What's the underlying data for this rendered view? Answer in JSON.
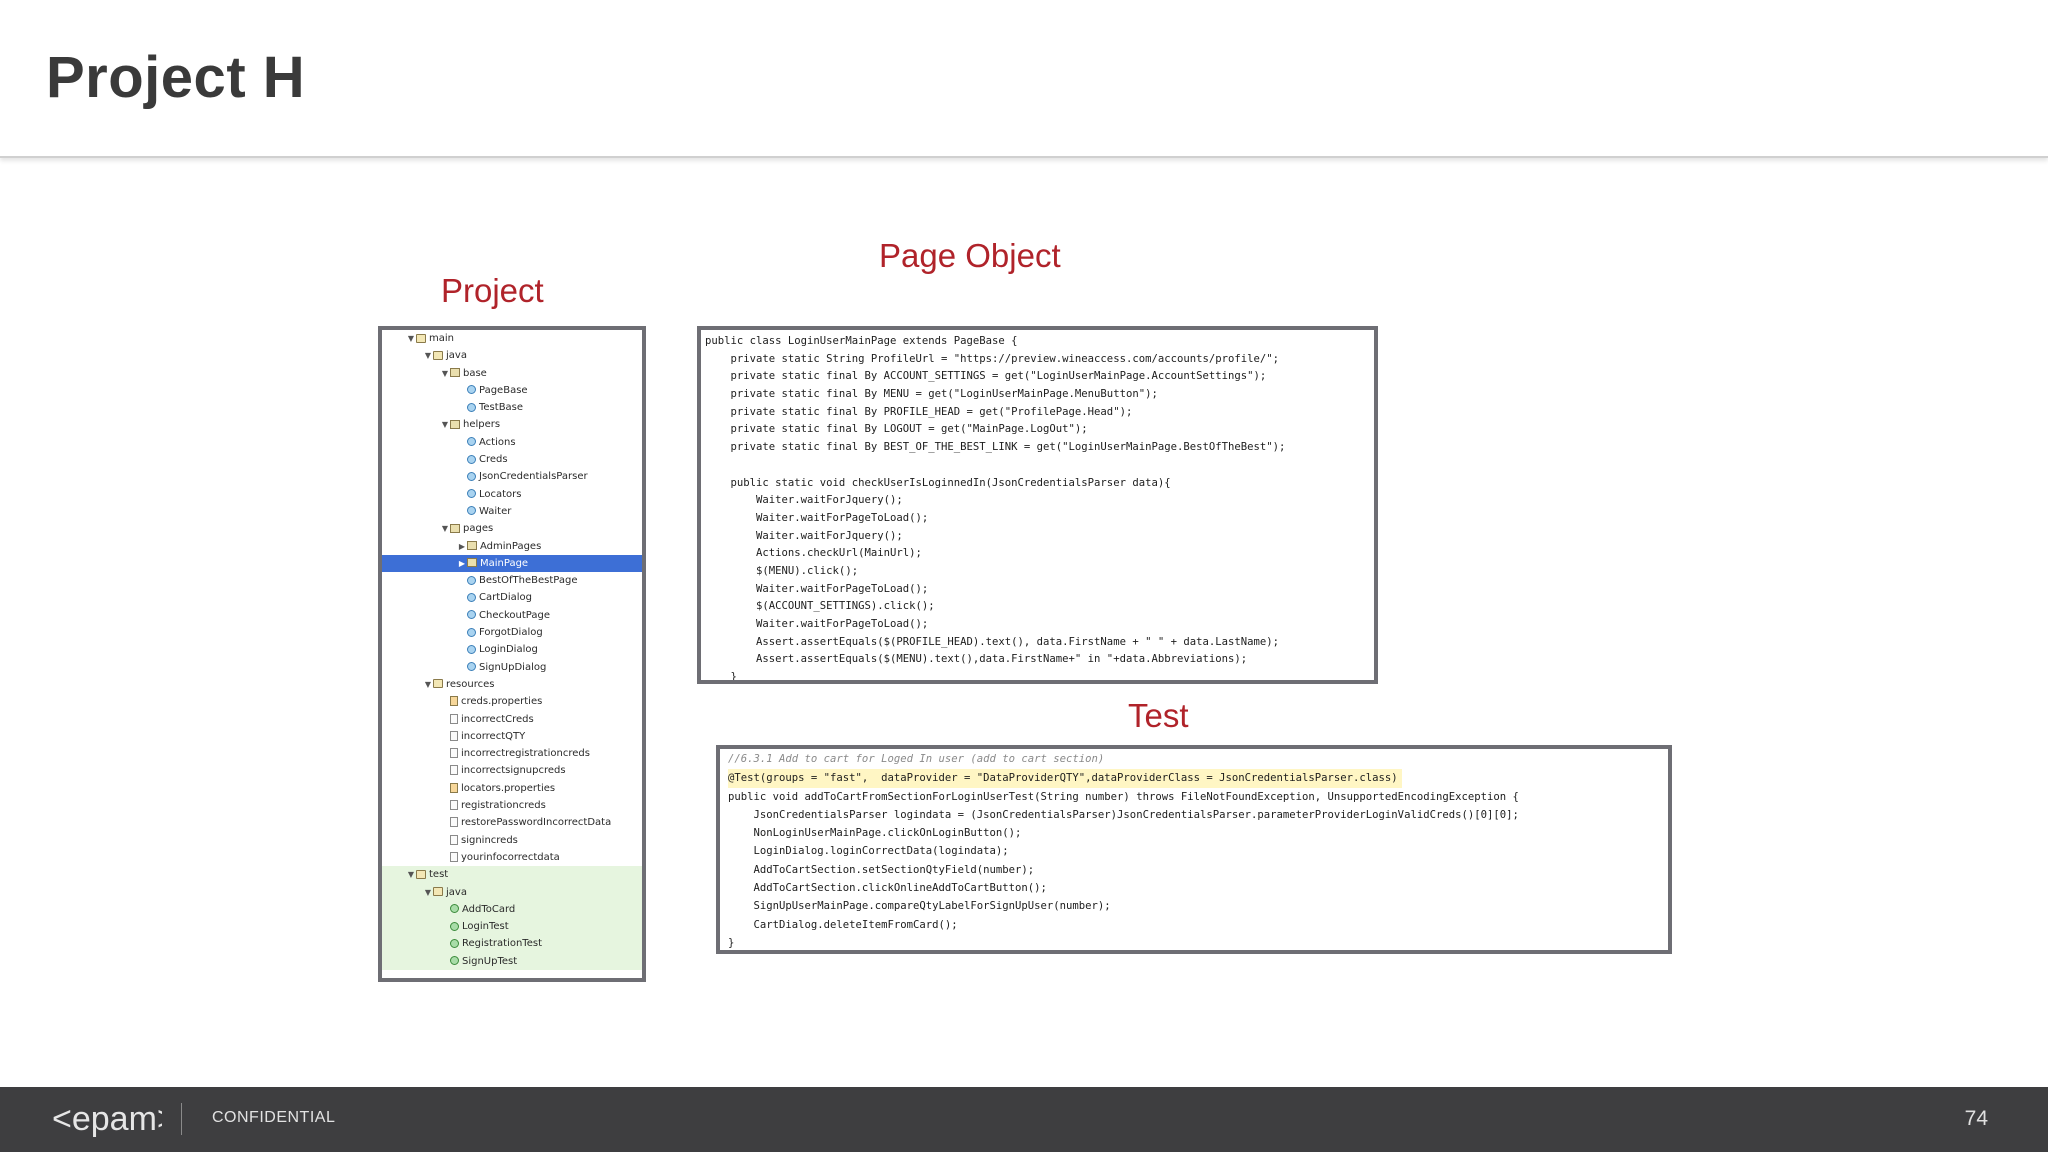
{
  "slide": {
    "title": "Project H"
  },
  "sections": {
    "project": "Project",
    "page_object": "Page Object",
    "test": "Test"
  },
  "tree": [
    {
      "label": "main",
      "icon": "folder-icon",
      "toggle": "▼",
      "indent": 0
    },
    {
      "label": "java",
      "icon": "folder-icon",
      "toggle": "▼",
      "indent": 1
    },
    {
      "label": "base",
      "icon": "package-icon",
      "toggle": "▼",
      "indent": 2
    },
    {
      "label": "PageBase",
      "icon": "class-icon",
      "toggle": "",
      "indent": 3
    },
    {
      "label": "TestBase",
      "icon": "class-icon",
      "toggle": "",
      "indent": 3
    },
    {
      "label": "helpers",
      "icon": "package-icon",
      "toggle": "▼",
      "indent": 2
    },
    {
      "label": "Actions",
      "icon": "class-icon",
      "toggle": "",
      "indent": 3
    },
    {
      "label": "Creds",
      "icon": "class-icon",
      "toggle": "",
      "indent": 3
    },
    {
      "label": "JsonCredentialsParser",
      "icon": "class-icon",
      "toggle": "",
      "indent": 3
    },
    {
      "label": "Locators",
      "icon": "class-icon",
      "toggle": "",
      "indent": 3
    },
    {
      "label": "Waiter",
      "icon": "class-icon",
      "toggle": "",
      "indent": 3
    },
    {
      "label": "pages",
      "icon": "package-icon",
      "toggle": "▼",
      "indent": 2
    },
    {
      "label": "AdminPages",
      "icon": "package-icon",
      "toggle": "▶",
      "indent": 3
    },
    {
      "label": "MainPage",
      "icon": "package-icon",
      "toggle": "▶",
      "indent": 3,
      "selected": true
    },
    {
      "label": "BestOfTheBestPage",
      "icon": "class-icon",
      "toggle": "",
      "indent": 3
    },
    {
      "label": "CartDialog",
      "icon": "class-icon",
      "toggle": "",
      "indent": 3
    },
    {
      "label": "CheckoutPage",
      "icon": "class-icon",
      "toggle": "",
      "indent": 3
    },
    {
      "label": "ForgotDialog",
      "icon": "class-icon",
      "toggle": "",
      "indent": 3
    },
    {
      "label": "LoginDialog",
      "icon": "class-icon",
      "toggle": "",
      "indent": 3
    },
    {
      "label": "SignUpDialog",
      "icon": "class-icon",
      "toggle": "",
      "indent": 3
    },
    {
      "label": "resources",
      "icon": "folder-icon",
      "toggle": "▼",
      "indent": 1
    },
    {
      "label": "creds.properties",
      "icon": "properties-file-icon",
      "toggle": "",
      "indent": 2
    },
    {
      "label": "incorrectCreds",
      "icon": "file-icon",
      "toggle": "",
      "indent": 2
    },
    {
      "label": "incorrectQTY",
      "icon": "file-icon",
      "toggle": "",
      "indent": 2
    },
    {
      "label": "incorrectregistrationcreds",
      "icon": "file-icon",
      "toggle": "",
      "indent": 2
    },
    {
      "label": "incorrectsignupcreds",
      "icon": "file-icon",
      "toggle": "",
      "indent": 2
    },
    {
      "label": "locators.properties",
      "icon": "properties-file-icon",
      "toggle": "",
      "indent": 2
    },
    {
      "label": "registrationcreds",
      "icon": "file-icon",
      "toggle": "",
      "indent": 2
    },
    {
      "label": "restorePasswordIncorrectData",
      "icon": "file-icon",
      "toggle": "",
      "indent": 2
    },
    {
      "label": "signincreds",
      "icon": "file-icon",
      "toggle": "",
      "indent": 2
    },
    {
      "label": "yourinfocorrectdata",
      "icon": "file-icon",
      "toggle": "",
      "indent": 2
    },
    {
      "label": "test",
      "icon": "folder-icon",
      "toggle": "▼",
      "indent": 0,
      "green": true
    },
    {
      "label": "java",
      "icon": "folder-icon",
      "toggle": "▼",
      "indent": 1,
      "green": true
    },
    {
      "label": "AddToCard",
      "icon": "test-class-icon",
      "toggle": "",
      "indent": 2,
      "green": true
    },
    {
      "label": "LoginTest",
      "icon": "test-class-icon",
      "toggle": "",
      "indent": 2,
      "green": true
    },
    {
      "label": "RegistrationTest",
      "icon": "test-class-icon",
      "toggle": "",
      "indent": 2,
      "green": true
    },
    {
      "label": "SignUpTest",
      "icon": "test-class-icon",
      "toggle": "",
      "indent": 2,
      "green": true
    }
  ],
  "page_object_code": [
    "public class LoginUserMainPage extends PageBase {",
    "    private static String ProfileUrl = \"https://preview.wineaccess.com/accounts/profile/\";",
    "    private static final By ACCOUNT_SETTINGS = get(\"LoginUserMainPage.AccountSettings\");",
    "    private static final By MENU = get(\"LoginUserMainPage.MenuButton\");",
    "    private static final By PROFILE_HEAD = get(\"ProfilePage.Head\");",
    "    private static final By LOGOUT = get(\"MainPage.LogOut\");",
    "    private static final By BEST_OF_THE_BEST_LINK = get(\"LoginUserMainPage.BestOfTheBest\");",
    "",
    "    public static void checkUserIsLoginnedIn(JsonCredentialsParser data){",
    "        Waiter.waitForJquery();",
    "        Waiter.waitForPageToLoad();",
    "        Waiter.waitForJquery();",
    "        Actions.checkUrl(MainUrl);",
    "        $(MENU).click();",
    "        Waiter.waitForPageToLoad();",
    "        $(ACCOUNT_SETTINGS).click();",
    "        Waiter.waitForPageToLoad();",
    "        Assert.assertEquals($(PROFILE_HEAD).text(), data.FirstName + \" \" + data.LastName);",
    "        Assert.assertEquals($(MENU).text(),data.FirstName+\" in \"+data.Abbreviations);",
    "    }"
  ],
  "test_code": [
    "//6.3.1 Add to cart for Loged In user (add to cart section)",
    "@Test(groups = \"fast\",  dataProvider = \"DataProviderQTY\",dataProviderClass = JsonCredentialsParser.class)",
    "public void addToCartFromSectionForLoginUserTest(String number) throws FileNotFoundException, UnsupportedEncodingException {",
    "    JsonCredentialsParser logindata = (JsonCredentialsParser)JsonCredentialsParser.parameterProviderLoginValidCreds()[0][0];",
    "    NonLoginUserMainPage.clickOnLoginButton();",
    "    LoginDialog.loginCorrectData(logindata);",
    "    AddToCartSection.setSectionQtyField(number);",
    "    AddToCartSection.clickOnlineAddToCartButton();",
    "    SignUpUserMainPage.compareQtyLabelForSignUpUser(number);",
    "    CartDialog.deleteItemFromCard();",
    "}"
  ],
  "footer": {
    "logo_text": "<epam>",
    "confidential": "CONFIDENTIAL",
    "page_number": "74"
  },
  "colors": {
    "section_label": "#b0232a",
    "footer_bg": "#3e3e40",
    "selection": "#3d6fd6"
  }
}
